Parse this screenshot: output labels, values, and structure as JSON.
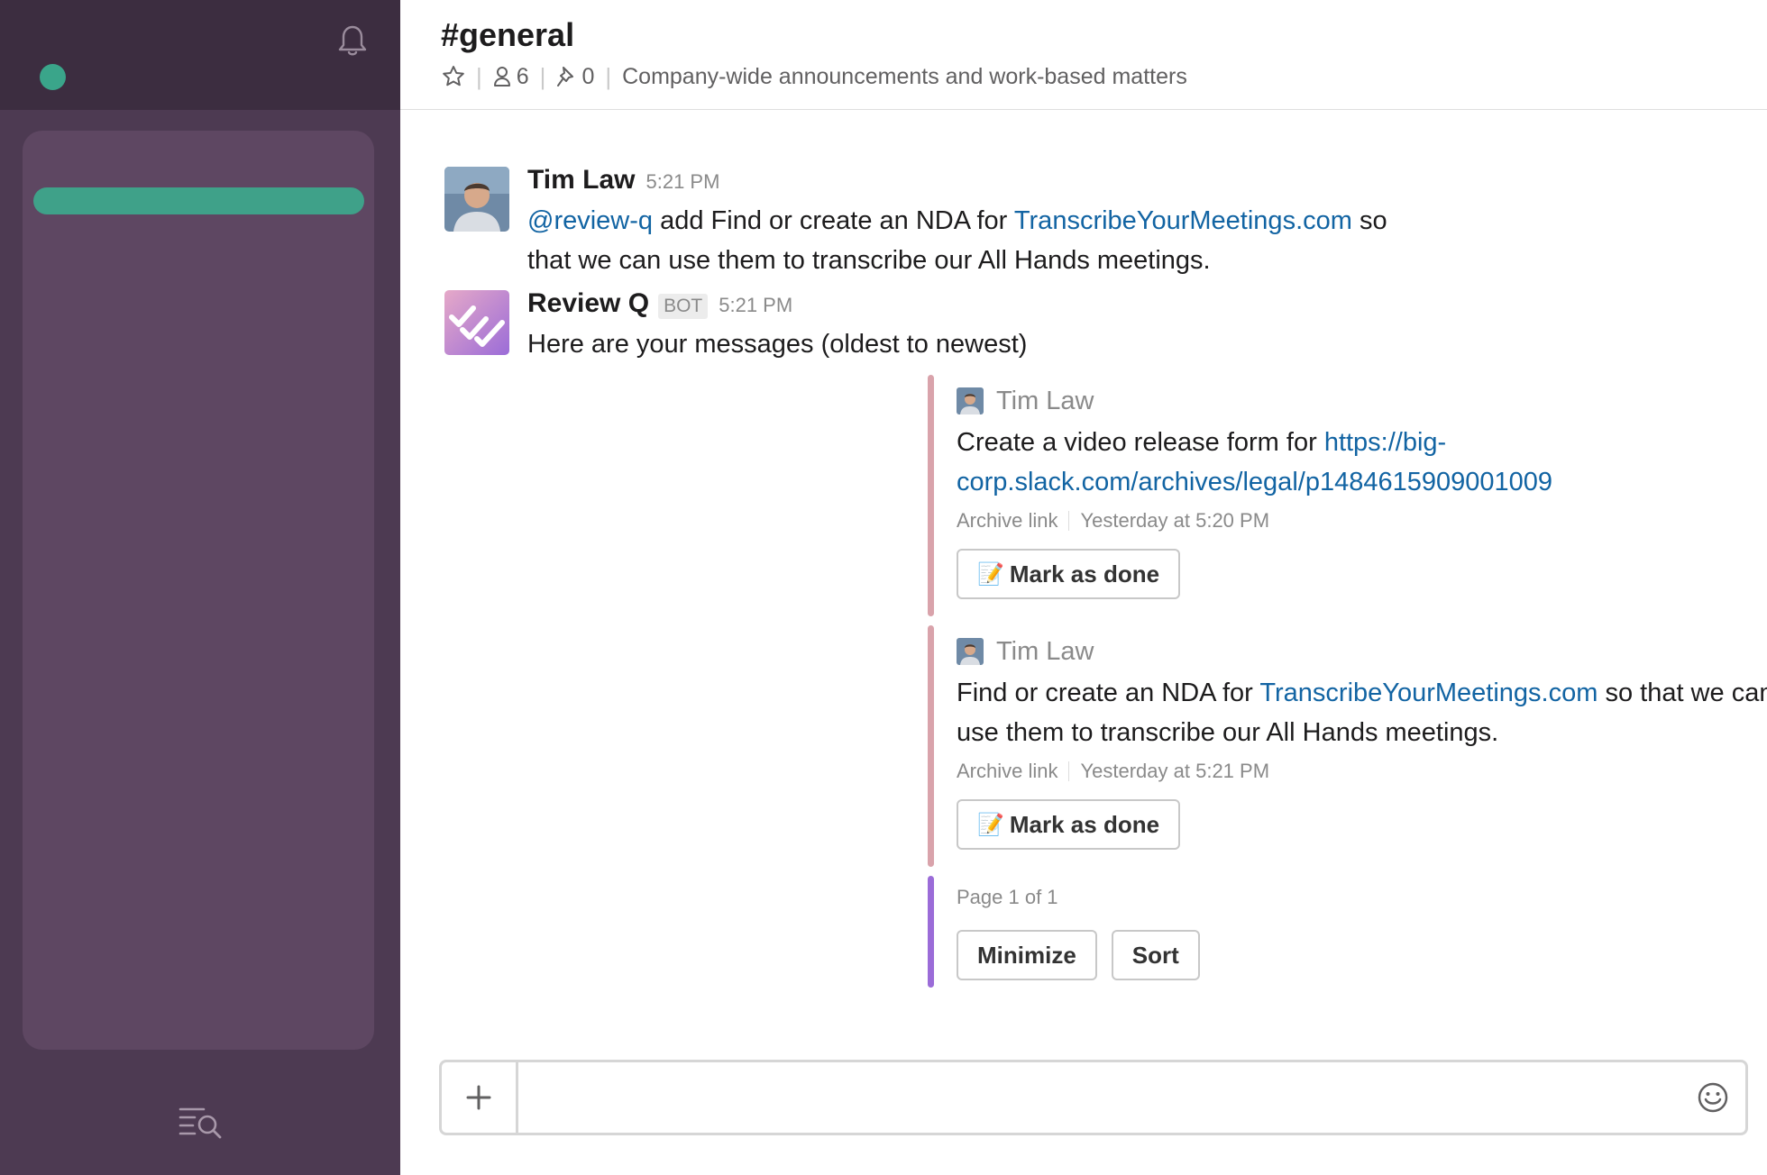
{
  "sidebar": {
    "presence_color": "#3aa58a",
    "icons": {
      "notifications": "bell-icon",
      "search": "search-list-icon"
    }
  },
  "header": {
    "channel_name": "#general",
    "member_count": "6",
    "pinned_count": "0",
    "topic": "Company-wide announcements and work-based matters",
    "icons": {
      "star": "star-icon",
      "members": "person-icon",
      "pins": "pin-icon"
    }
  },
  "messages": [
    {
      "author": "Tim Law",
      "time": "5:21 PM",
      "mention": "@review-q",
      "text_a": " add Find or create an NDA for ",
      "link": "TranscribeYourMeetings.com",
      "text_b": " so that we can use them to transcribe our All Hands meetings."
    },
    {
      "author": "Review Q",
      "badge": "BOT",
      "time": "5:21 PM",
      "text": "Here are your messages (oldest to newest)"
    }
  ],
  "attachments": [
    {
      "author": "Tim Law",
      "text": "Create a video release form for ",
      "link": "https://big-corp.slack.com/archives/legal/p1484615909001009",
      "footer_link": "Archive link",
      "footer_time": "Yesterday at 5:20 PM",
      "button_emoji": "📝",
      "button_label": "Mark as done",
      "color": "#d9a3ab"
    },
    {
      "author": "Tim Law",
      "text_a": "Find or create an NDA for ",
      "link": "TranscribeYourMeetings.com",
      "text_b": " so that we can use them to transcribe our All Hands meetings.",
      "footer_link": "Archive link",
      "footer_time": "Yesterday at 5:21 PM",
      "button_emoji": "📝",
      "button_label": "Mark as done",
      "color": "#d9a3ab"
    },
    {
      "page_text": "Page 1 of 1",
      "buttons": [
        "Minimize",
        "Sort"
      ],
      "color": "#9b6cd8"
    }
  ],
  "composer": {
    "placeholder": "",
    "icons": {
      "attach": "plus-icon",
      "emoji": "smiley-icon"
    }
  }
}
